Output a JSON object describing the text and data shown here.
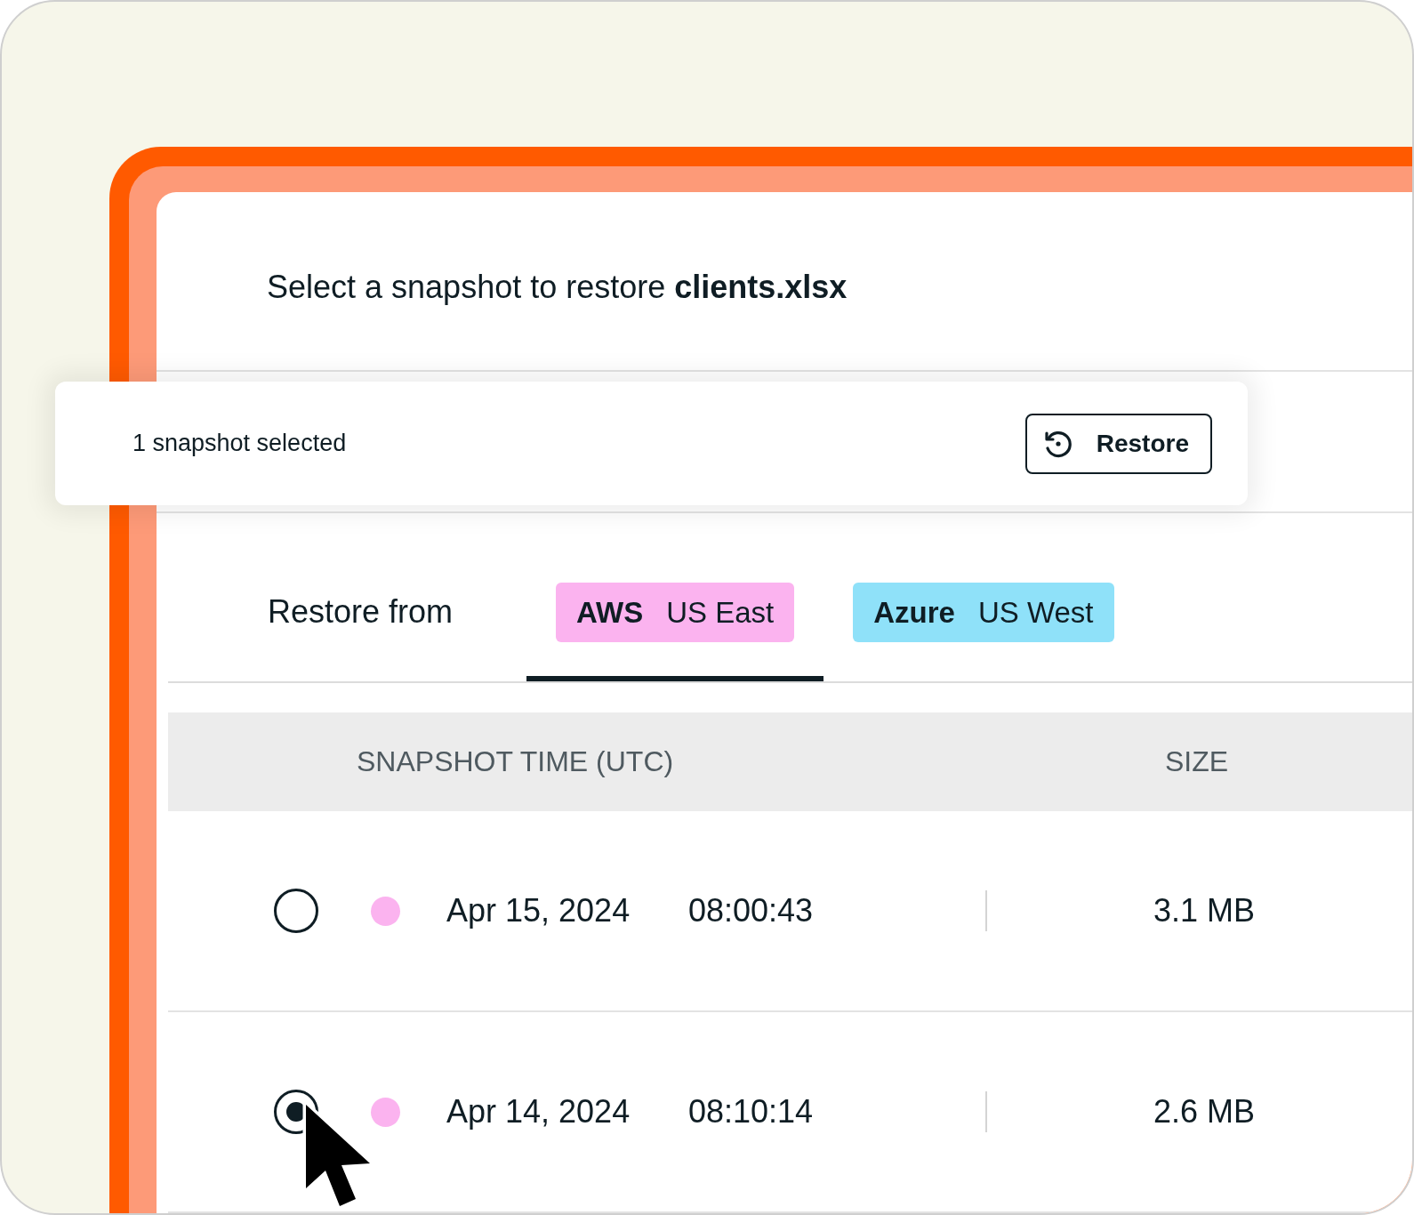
{
  "title": "Select a snapshot to restore **clients.xlsx**",
  "selection_bar": {
    "text": "1 snapshot selected",
    "button": "Restore"
  },
  "source": {
    "label": "Restore from",
    "tabs": [
      {
        "provider": "AWS",
        "region": "US East",
        "color": "#fbb3ef",
        "selected": true
      },
      {
        "provider": "Azure",
        "region": "US West",
        "color": "#8fe1f9",
        "selected": false
      }
    ]
  },
  "table": {
    "columns": [
      "SNAPSHOT TIME (UTC)",
      "SIZE"
    ],
    "rows": [
      {
        "date": "Apr 15, 2024",
        "time": "08:00:43",
        "size": "3.1 MB",
        "color": "#fbb3ef",
        "selected": false
      },
      {
        "date": "Apr 14, 2024",
        "time": "08:10:14",
        "size": "2.6 MB",
        "color": "#fbb3ef",
        "selected": true
      }
    ]
  }
}
